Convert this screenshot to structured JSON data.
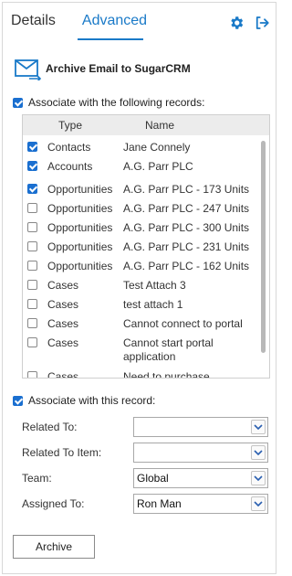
{
  "tabs": [
    {
      "label": "Details",
      "active": false
    },
    {
      "label": "Advanced",
      "active": true
    }
  ],
  "icons": {
    "settings": "gear-icon",
    "logout": "logout-icon",
    "accent": "#1a7ac8"
  },
  "archive_header": {
    "title": "Archive Email to SugarCRM",
    "logo": "email-archive-icon"
  },
  "associate_records": {
    "label": "Associate with the following records:",
    "checked": true
  },
  "records": {
    "columns": [
      "Type",
      "Name"
    ],
    "rows": [
      {
        "type": "Contacts",
        "name": "Jane Connely",
        "checked": true
      },
      {
        "type": "Accounts",
        "name": "A.G. Parr PLC",
        "checked": true
      },
      {
        "type": "Opportunities",
        "name": "A.G. Parr PLC - 173 Units",
        "checked": true
      },
      {
        "type": "Opportunities",
        "name": "A.G. Parr PLC - 247 Units",
        "checked": false
      },
      {
        "type": "Opportunities",
        "name": "A.G. Parr PLC - 300 Units",
        "checked": false
      },
      {
        "type": "Opportunities",
        "name": "A.G. Parr PLC - 231 Units",
        "checked": false
      },
      {
        "type": "Opportunities",
        "name": "A.G. Parr PLC - 162 Units",
        "checked": false
      },
      {
        "type": "Cases",
        "name": "Test Attach 3",
        "checked": false
      },
      {
        "type": "Cases",
        "name": "test attach 1",
        "checked": false
      },
      {
        "type": "Cases",
        "name": "Cannot connect to portal",
        "checked": false
      },
      {
        "type": "Cases",
        "name": "Cannot start portal application",
        "checked": false
      },
      {
        "type": "Cases",
        "name": "Need to purchase",
        "checked": false
      }
    ]
  },
  "associate_record": {
    "label": "Associate with this record:",
    "checked": true
  },
  "form": {
    "related_to": {
      "label": "Related To:",
      "value": ""
    },
    "related_to_item": {
      "label": "Related To Item:",
      "value": ""
    },
    "team": {
      "label": "Team:",
      "value": "Global"
    },
    "assigned_to": {
      "label": "Assigned To:",
      "value": "Ron Man"
    }
  },
  "archive_button": {
    "label": "Archive"
  }
}
